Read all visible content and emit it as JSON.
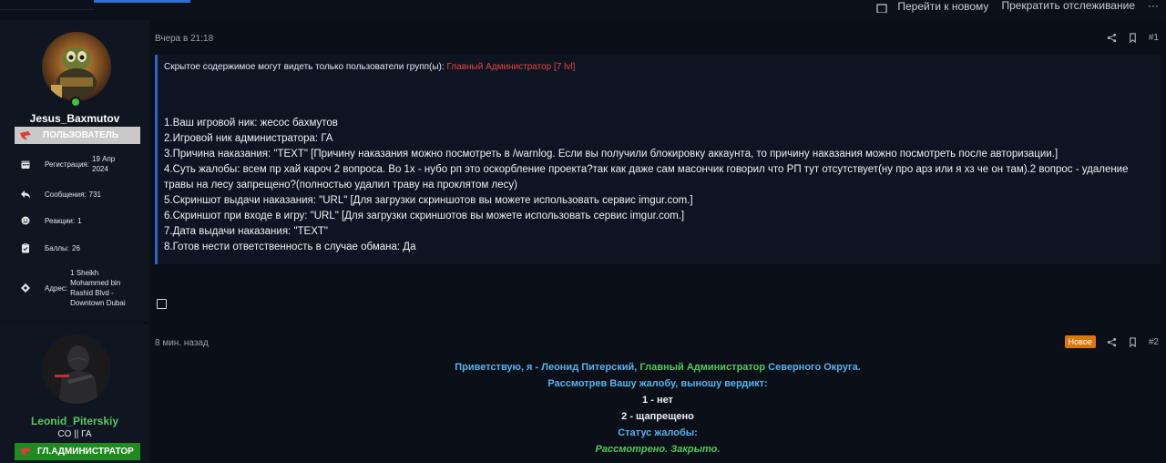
{
  "topbar": {
    "go_to_new": "Перейти к новому",
    "stop_watching": "Прекратить отслеживание",
    "more": "···"
  },
  "posts": [
    {
      "author": {
        "name": "Jesus_Baxmutov",
        "name_color": "#ffffff",
        "role": "ПОЛЬЗОВАТЕЛЬ",
        "role_bg": "#c9c9c9",
        "role_color": "#ffffff",
        "stats": [
          {
            "icon": "calendar-icon",
            "label": "Регистрация:",
            "value": "19 Апр 2024"
          },
          {
            "icon": "reply-icon",
            "label": "Сообщения:",
            "value": "731"
          },
          {
            "icon": "smile-icon",
            "label": "Реакции:",
            "value": "1"
          },
          {
            "icon": "clipboard-icon",
            "label": "Баллы:",
            "value": "26"
          },
          {
            "icon": "location-icon",
            "label": "Адрес:",
            "value": "1 Sheikh Mohammed bin Rashid Blvd - Downtown Dubai"
          }
        ]
      },
      "date": "Вчера в 21:18",
      "number": "#1",
      "hidden_notice": "Скрытое содержимое могут видеть только пользователи групп(ы):",
      "hidden_group": "Главный Администратор [7 lvl]",
      "lines": [
        "1.Ваш игровой ник: жесос бахмутов",
        "2.Игровой ник администратора: ГА",
        "3.Причина наказания: \"TEXT\" [Причину наказания можно посмотреть в /warnlog. Если вы получили блокировку аккаунта, то причину наказания можно посмотреть после авторизации.]",
        "4.Суть жалобы: всем пр хай кароч 2 вопроса. Во 1х - нубо рп это оскорбление проекта?так как даже сам масончик говорил что РП тут отсутствует(ну про арз или я хз че он там).2 вопрос - удаление травы на лесу запрещено?(полностью удалил траву на проклятом лесу)",
        "5.Скриншот выдачи наказания: \"URL\" [Для загрузки скриншотов вы можете использовать сервис imgur.com.]",
        "6.Скриншот при входе в игру: \"URL\" [Для загрузки скриншотов вы можете использовать сервис imgur.com.]",
        "7.Дата выдачи наказания: \"TEXT\"",
        "8.Готов нести ответственность в случае обмана: Да"
      ]
    },
    {
      "author": {
        "name": "Leonid_Piterskiy",
        "name_color": "#57c95c",
        "title": "CO || ГА",
        "role": "ГЛ.АДМИНИСТРАТОР",
        "role_bg": "#1f8a1f",
        "role_color": "#ffffff"
      },
      "date": "8 мин. назад",
      "badge": "Новое",
      "number": "#2",
      "verdict": {
        "greeting_a": "Приветствую, я - Леонид Питерский,",
        "greeting_b": "Главный Администратор",
        "greeting_c": "Северного Округа.",
        "reviewed": "Рассмотрев Вашу жалобу, выношу вердикт:",
        "item1": "1 - нет",
        "item2": "2 - щапрещено",
        "status_label": "Статус жалобы:",
        "status_value": "Рассмотрено. Закрыто."
      }
    }
  ]
}
